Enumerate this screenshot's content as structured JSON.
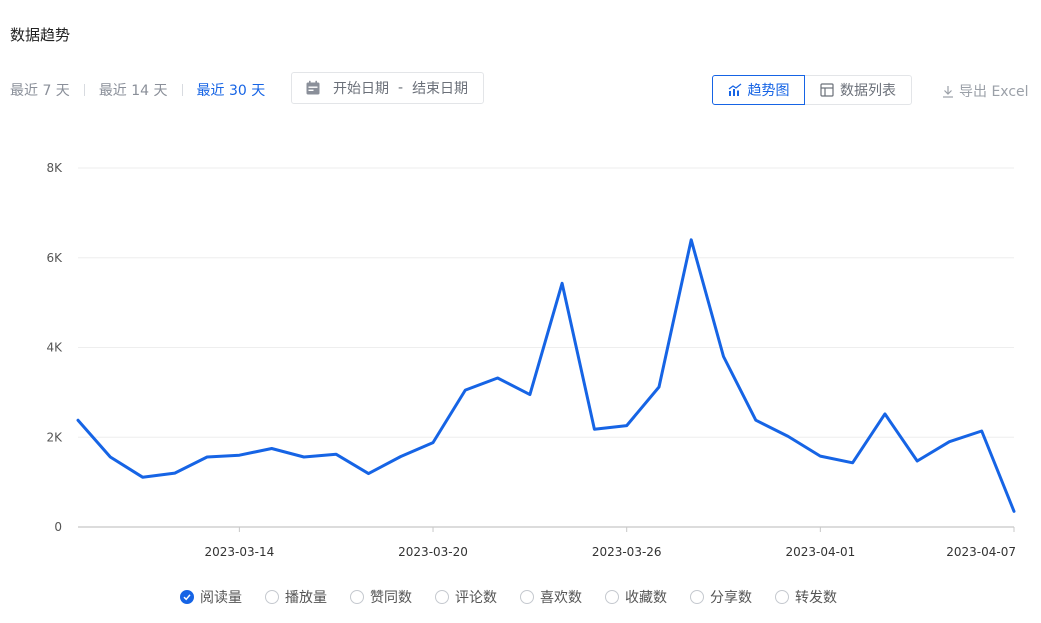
{
  "title": "数据趋势",
  "ranges": [
    {
      "label": "最近 7 天",
      "active": false
    },
    {
      "label": "最近 14 天",
      "active": false
    },
    {
      "label": "最近 30 天",
      "active": true
    }
  ],
  "datepicker": {
    "start": "开始日期",
    "sep": "-",
    "end": "结束日期"
  },
  "view": {
    "trend": "趋势图",
    "list": "数据列表",
    "active": "trend"
  },
  "export_label": "导出 Excel",
  "accent": "#1664e5",
  "legend": [
    {
      "label": "阅读量",
      "checked": true
    },
    {
      "label": "播放量",
      "checked": false
    },
    {
      "label": "赞同数",
      "checked": false
    },
    {
      "label": "评论数",
      "checked": false
    },
    {
      "label": "喜欢数",
      "checked": false
    },
    {
      "label": "收藏数",
      "checked": false
    },
    {
      "label": "分享数",
      "checked": false
    },
    {
      "label": "转发数",
      "checked": false
    }
  ],
  "chart_data": {
    "type": "line",
    "x": [
      "2023-03-09",
      "2023-03-10",
      "2023-03-11",
      "2023-03-12",
      "2023-03-13",
      "2023-03-14",
      "2023-03-15",
      "2023-03-16",
      "2023-03-17",
      "2023-03-18",
      "2023-03-19",
      "2023-03-20",
      "2023-03-21",
      "2023-03-22",
      "2023-03-23",
      "2023-03-24",
      "2023-03-25",
      "2023-03-26",
      "2023-03-27",
      "2023-03-28",
      "2023-03-29",
      "2023-03-30",
      "2023-03-31",
      "2023-04-01",
      "2023-04-02",
      "2023-04-03",
      "2023-04-04",
      "2023-04-05",
      "2023-04-06",
      "2023-04-07"
    ],
    "series": [
      {
        "name": "阅读量",
        "color": "#1664e5",
        "values": [
          2380,
          1560,
          1110,
          1200,
          1560,
          1600,
          1750,
          1560,
          1620,
          1190,
          1570,
          1880,
          3050,
          3320,
          2950,
          5430,
          2180,
          2260,
          3120,
          6400,
          3800,
          2380,
          2020,
          1580,
          1430,
          2520,
          1470,
          1900,
          2140,
          350
        ]
      }
    ],
    "x_ticks": [
      "2023-03-14",
      "2023-03-20",
      "2023-03-26",
      "2023-04-01",
      "2023-04-07"
    ],
    "y_ticks": [
      0,
      2000,
      4000,
      6000,
      8000
    ],
    "y_tick_labels": [
      "0",
      "2K",
      "4K",
      "6K",
      "8K"
    ],
    "ylim": [
      0,
      8000
    ],
    "grid": true,
    "legend_position": "bottom"
  }
}
